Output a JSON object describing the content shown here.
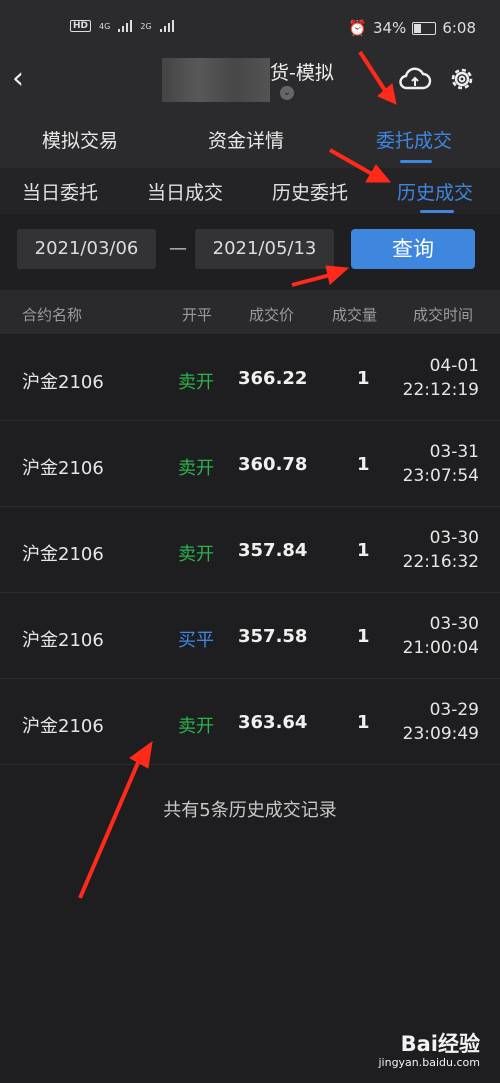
{
  "status_bar": {
    "hd": "HD",
    "net1": "4G",
    "net2": "2G",
    "battery": "34%",
    "time": "6:08"
  },
  "header": {
    "title": "货-模拟",
    "back_icon": "chevron-left-icon",
    "cloud_icon": "cloud-sync-icon",
    "settings_icon": "gear-icon"
  },
  "main_tabs": [
    {
      "label": "模拟交易"
    },
    {
      "label": "资金详情"
    },
    {
      "label": "委托成交",
      "active": true
    }
  ],
  "sub_tabs": [
    {
      "label": "当日委托"
    },
    {
      "label": "当日成交"
    },
    {
      "label": "历史委托"
    },
    {
      "label": "历史成交",
      "active": true
    }
  ],
  "date_filter": {
    "start": "2021/03/06",
    "separator": "—",
    "end": "2021/05/13",
    "query_label": "查询"
  },
  "table": {
    "headers": [
      "合约名称",
      "开平",
      "成交价",
      "成交量",
      "成交时间"
    ],
    "rows": [
      {
        "name": "沪金2106",
        "direction": "卖开",
        "price": "366.22",
        "qty": "1",
        "date": "04-01",
        "time": "22:12:19"
      },
      {
        "name": "沪金2106",
        "direction": "卖开",
        "price": "360.78",
        "qty": "1",
        "date": "03-31",
        "time": "23:07:54"
      },
      {
        "name": "沪金2106",
        "direction": "卖开",
        "price": "357.84",
        "qty": "1",
        "date": "03-30",
        "time": "22:16:32"
      },
      {
        "name": "沪金2106",
        "direction": "买平",
        "price": "357.58",
        "qty": "1",
        "date": "03-30",
        "time": "21:00:04"
      },
      {
        "name": "沪金2106",
        "direction": "卖开",
        "price": "363.64",
        "qty": "1",
        "date": "03-29",
        "time": "23:09:49"
      }
    ]
  },
  "summary": "共有5条历史成交记录",
  "watermark": {
    "logo": "Bai经验",
    "url": "jingyan.baidu.com"
  },
  "colors": {
    "accent": "#3f86df",
    "sell_open": "#2bb24c",
    "buy_close": "#3f86df",
    "annotation_arrow": "#ff2a1a"
  }
}
